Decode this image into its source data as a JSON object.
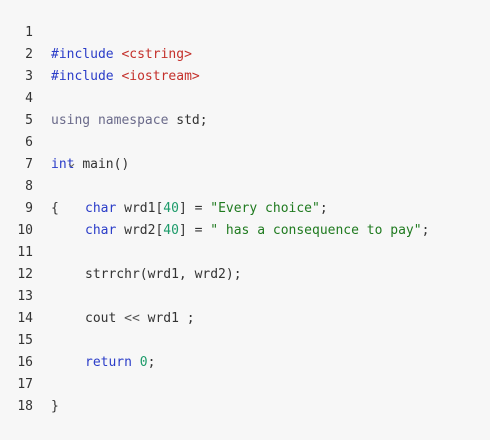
{
  "editor": {
    "line_numbers": [
      "1",
      "2",
      "3",
      "4",
      "5",
      "6",
      "7",
      "8",
      "9",
      "10",
      "11",
      "12",
      "13",
      "14",
      "15",
      "16",
      "17",
      "18"
    ],
    "lines": {
      "l1": {
        "kw": "#include",
        "hdr": "<cstring>"
      },
      "l2": {
        "kw": "#include",
        "hdr": "<iostream>"
      },
      "l4": {
        "kw": "using",
        "kw2": "namespace",
        "rest": "std;"
      },
      "l6": {
        "type": "int",
        "rest": "main()"
      },
      "l7": {
        "text": "{"
      },
      "l8": {
        "type": "char",
        "a": "wrd1[",
        "num": "40",
        "b": "] = ",
        "str": "\"Every choice\"",
        "c": ";"
      },
      "l9": {
        "type": "char",
        "a": "wrd2[",
        "num": "40",
        "b": "] = ",
        "str": "\" has a consequence to pay\"",
        "c": ";"
      },
      "l11": {
        "text": "strrchr(wrd1, wrd2);"
      },
      "l13": {
        "a": "cout ",
        "op": "<<",
        "b": " wrd1 ",
        "c": ";"
      },
      "l15": {
        "kw": "return",
        "num": "0",
        "c": ";"
      },
      "l17": {
        "text": "}"
      }
    },
    "fold_icon": "chevron-down-icon"
  },
  "colors": {
    "background": "#f7f7f7",
    "keyword": "#2a3cc8",
    "header": "#c4302b",
    "string": "#1f7a1f",
    "number": "#1d9b6a"
  }
}
